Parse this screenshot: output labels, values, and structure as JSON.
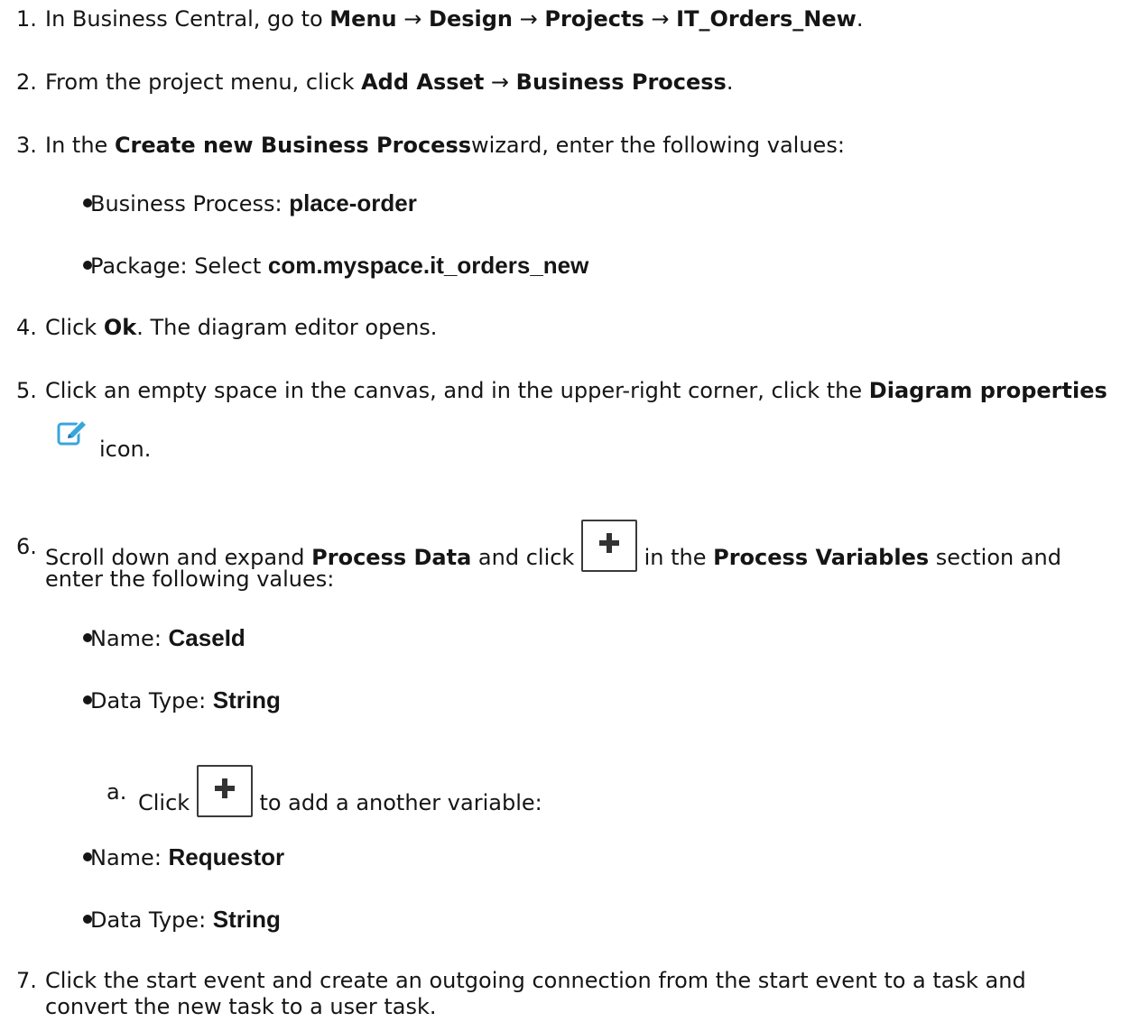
{
  "steps": [
    {
      "num": "1.",
      "text1": "In Business Central, go to ",
      "b1": "Menu",
      "s1": " → ",
      "b2": "Design",
      "s2": " → ",
      "b3": "Projects",
      "s3": " → ",
      "b4": "IT_Orders_New",
      "end": "."
    },
    {
      "num": "2.",
      "text1": "From the project menu, click ",
      "b1": "Add Asset",
      "s1": " → ",
      "b2": "Business Process",
      "end": "."
    },
    {
      "num": "3.",
      "text1": "In the ",
      "b1": "Create new Business Process",
      "text2": "wizard, enter the following values:",
      "bullets": [
        {
          "label": "Business Process",
          "sep": ": ",
          "value": "place-order"
        },
        {
          "label": "Package",
          "sep": ": Select ",
          "value": "com.myspace.it_orders_new"
        }
      ]
    },
    {
      "num": "4.",
      "text1": "Click ",
      "b1": "Ok",
      "text2": ". The diagram editor opens."
    },
    {
      "num": "5.",
      "text1": "Click an empty space in the canvas, and in the upper-right corner, click the ",
      "b1": "Diagram properties",
      "text2": "icon.",
      "icon": "edit-pencil-icon"
    },
    {
      "num": "6.",
      "text1": "Scroll down and expand ",
      "b1": "Process Data",
      "text2": " and click ",
      "text3": " in the ",
      "b2": "Process Variables",
      "text4": " section and",
      "line2": "enter the following values:",
      "bullets": [
        {
          "label": "Name",
          "sep": ": ",
          "value": "CaseId"
        },
        {
          "label": "Data Type",
          "sep": ": ",
          "value": "String"
        }
      ],
      "sub": {
        "num": "a.",
        "text1": "Click ",
        "text2": " to add a another variable:"
      },
      "bullets2": [
        {
          "label": "Name",
          "sep": ": ",
          "value": "Requestor"
        },
        {
          "label": "Data Type",
          "sep": ": ",
          "value": "String"
        }
      ]
    },
    {
      "num": "7.",
      "text1": "Click the start event and create an outgoing connection from the start event to a task and",
      "line2": "convert the new task to a user task."
    }
  ],
  "icons": {
    "plus": "plus-icon",
    "edit": "edit-pencil-icon"
  },
  "colors": {
    "edit_icon": "#39a5dc",
    "text": "#151515"
  }
}
